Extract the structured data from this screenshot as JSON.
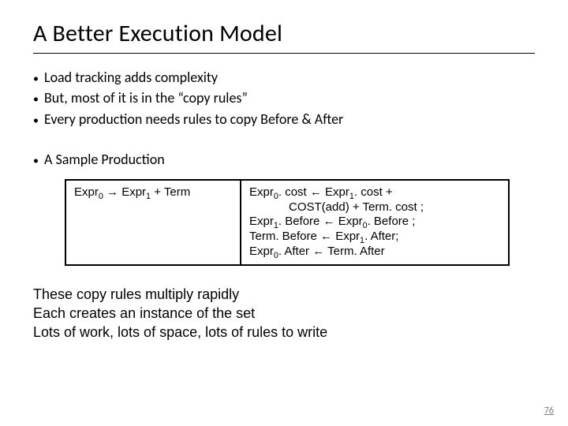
{
  "title": "A Better Execution Model",
  "bullets": [
    "Load tracking adds complexity",
    "But, most of it is in the “copy rules”",
    "Every production needs rules to copy Before & After"
  ],
  "subhead": "A Sample Production",
  "production": {
    "lhs": {
      "pre0": "Expr",
      "sub0": "0",
      "arrow": " → ",
      "pre1": "Expr",
      "sub1": "1",
      "tail": " + Term"
    },
    "rules": {
      "l1": {
        "a": "Expr",
        "s1": "0",
        "b": ". cost ← Expr",
        "s2": "1",
        "c": ". cost +"
      },
      "l2": {
        "a": "COST(add) + Term. cost ;"
      },
      "l3": {
        "a": "Expr",
        "s1": "1",
        "b": ". Before ← Expr",
        "s2": "0",
        "c": ". Before ;"
      },
      "l4": {
        "a": "Term. Before ← Expr",
        "s1": "1",
        "b": ". After;"
      },
      "l5": {
        "a": "Expr",
        "s1": "0",
        "b": ". After ← Term. After"
      }
    }
  },
  "notes": [
    "These copy rules multiply rapidly",
    "Each creates an instance of the set",
    "Lots of work, lots of space, lots of rules to write"
  ],
  "page": "76"
}
